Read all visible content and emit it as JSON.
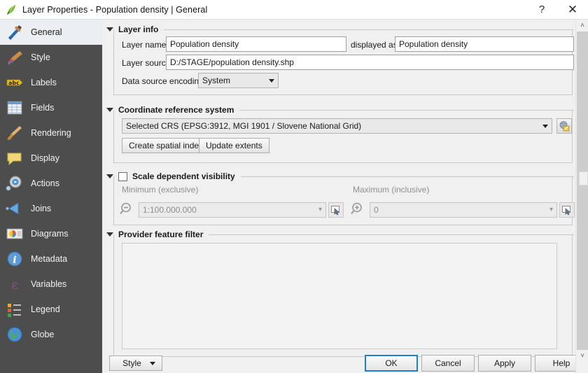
{
  "window": {
    "title": "Layer Properties - Population density | General",
    "app_icon": "qgis-leaf-icon",
    "help_button": "?",
    "close_button": "✕"
  },
  "sidebar": {
    "items": [
      {
        "label": "General",
        "icon": "hammer-wrench-icon",
        "selected": true
      },
      {
        "label": "Style",
        "icon": "paintbrush-color-icon",
        "selected": false
      },
      {
        "label": "Labels",
        "icon": "abc-label-icon",
        "selected": false
      },
      {
        "label": "Fields",
        "icon": "table-grid-icon",
        "selected": false
      },
      {
        "label": "Rendering",
        "icon": "broom-icon",
        "selected": false
      },
      {
        "label": "Display",
        "icon": "speech-bubble-icon",
        "selected": false
      },
      {
        "label": "Actions",
        "icon": "gear-play-icon",
        "selected": false
      },
      {
        "label": "Joins",
        "icon": "left-arrow-join-icon",
        "selected": false
      },
      {
        "label": "Diagrams",
        "icon": "pie-chart-panel-icon",
        "selected": false
      },
      {
        "label": "Metadata",
        "icon": "info-circle-icon",
        "selected": false
      },
      {
        "label": "Variables",
        "icon": "epsilon-icon",
        "selected": false
      },
      {
        "label": "Legend",
        "icon": "legend-list-icon",
        "selected": false
      },
      {
        "label": "Globe",
        "icon": "globe-icon",
        "selected": false
      }
    ]
  },
  "layer_info": {
    "group_title": "Layer info",
    "layer_name_label": "Layer name",
    "layer_name_value": "Population density",
    "displayed_as_label": "displayed as",
    "displayed_as_value": "Population density",
    "layer_source_label": "Layer source",
    "layer_source_value": "D:/STAGE/population density.shp",
    "encoding_label": "Data source encoding",
    "encoding_value": "System"
  },
  "crs": {
    "group_title": "Coordinate reference system",
    "selected_crs": "Selected CRS (EPSG:3912, MGI 1901 / Slovene National Grid)",
    "select_crs_icon": "globe-pencil-icon",
    "create_spatial_index": "Create spatial index",
    "update_extents": "Update extents"
  },
  "scale_visibility": {
    "group_title": "Scale dependent visibility",
    "checked": false,
    "minimum_label": "Minimum (exclusive)",
    "minimum_value": "1:100.000.000",
    "minimum_icon": "magnifier-minus-icon",
    "maximum_label": "Maximum (inclusive)",
    "maximum_value": "0",
    "maximum_icon": "magnifier-plus-icon",
    "pick_scale_icon": "canvas-scale-picker-icon"
  },
  "provider_filter": {
    "group_title": "Provider feature filter",
    "value": ""
  },
  "buttons": {
    "style": "Style",
    "ok": "OK",
    "cancel": "Cancel",
    "apply": "Apply",
    "help": "Help"
  },
  "scrollbar": {
    "up_arrow": "˄",
    "down_arrow": "˅"
  },
  "colors": {
    "sidebar_bg": "#4d4d4d",
    "content_bg": "#f0f0f0",
    "accent": "#1c7ed6",
    "disabled_text": "#8f8f8f"
  }
}
